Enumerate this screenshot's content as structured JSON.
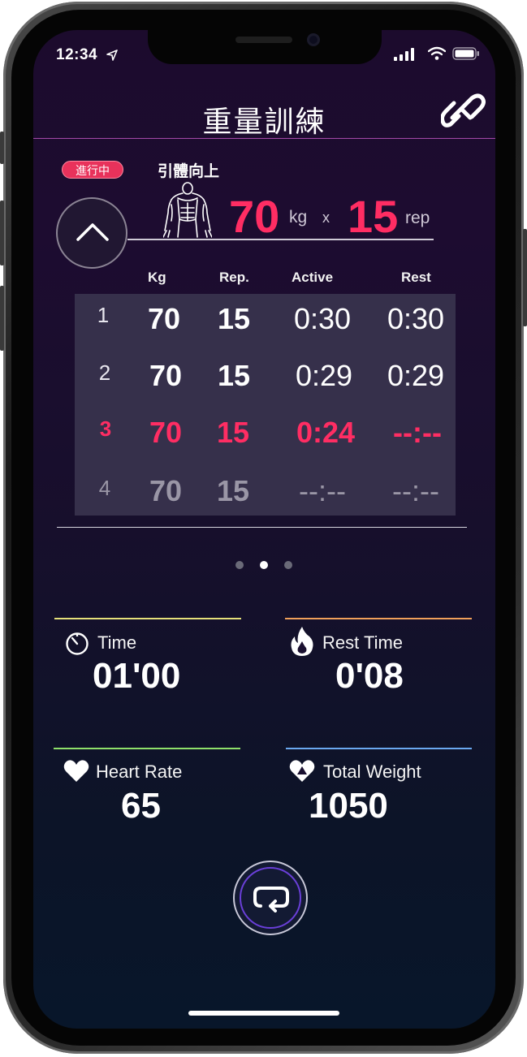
{
  "status_bar": {
    "time": "12:34"
  },
  "header": {
    "title": "重量訓練",
    "link_icon": "link-icon"
  },
  "current": {
    "badge": "進行中",
    "exercise": "引體向上",
    "weight": "70",
    "weight_unit": "kg",
    "times": "x",
    "reps": "15",
    "reps_unit": "rep"
  },
  "table": {
    "headers": [
      "Kg",
      "Rep.",
      "Active",
      "Rest"
    ],
    "rows": [
      {
        "index": "1",
        "kg": "70",
        "rep": "15",
        "active": "0:30",
        "rest": "0:30",
        "state": "done"
      },
      {
        "index": "2",
        "kg": "70",
        "rep": "15",
        "active": "0:29",
        "rest": "0:29",
        "state": "done"
      },
      {
        "index": "3",
        "kg": "70",
        "rep": "15",
        "active": "0:24",
        "rest": "--:--",
        "state": "active"
      },
      {
        "index": "4",
        "kg": "70",
        "rep": "15",
        "active": "--:--",
        "rest": "--:--",
        "state": "pending"
      }
    ]
  },
  "pager": {
    "count": 3,
    "active": 2
  },
  "stats": {
    "time": {
      "label": "Time",
      "value": "01'00",
      "color": "#e5e07a"
    },
    "rest_time": {
      "label": "Rest Time",
      "value": "0'08",
      "color": "#f0a05a"
    },
    "heart_rate": {
      "label": "Heart Rate",
      "value": "65",
      "color": "#8ee06a"
    },
    "total_weight": {
      "label": "Total Weight",
      "value": "1050",
      "color": "#6aa8f0"
    }
  },
  "colors": {
    "accent_pink": "#ff2d63",
    "header_line": "#a349a8",
    "table_bg": "#36304b"
  }
}
